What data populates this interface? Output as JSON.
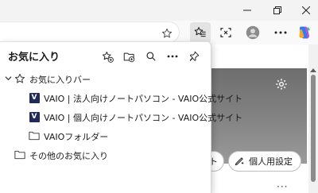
{
  "window": {
    "controls": [
      {
        "name": "minimize-icon"
      },
      {
        "name": "restore-icon"
      },
      {
        "name": "close-icon"
      }
    ]
  },
  "toolbar": {
    "icons": [
      "favorite-star-icon",
      "favorites-hub-icon",
      "screenshot-icon",
      "profile-avatar-icon",
      "more-menu-icon",
      "copilot-icon"
    ]
  },
  "favorites": {
    "title": "お気に入り",
    "actions": [
      "add-favorite-icon",
      "add-folder-icon",
      "search-icon",
      "more-icon",
      "pin-icon"
    ],
    "items": [
      {
        "label": "お気に入りバー",
        "type": "folder-root"
      },
      {
        "label": "VAIO | 法人向けノートパソコン - VAIO公式サイト",
        "type": "site"
      },
      {
        "label": "VAIO | 個人向けノートパソコン - VAIO公式サイト",
        "type": "site"
      },
      {
        "label": "VAIOフォルダー",
        "type": "folder"
      },
      {
        "label": "その他のお気に入り",
        "type": "folder"
      }
    ],
    "site_favicon_letter": "V"
  },
  "page": {
    "personal_settings_label": "個人用設定",
    "accent": "#1f2a5a"
  }
}
